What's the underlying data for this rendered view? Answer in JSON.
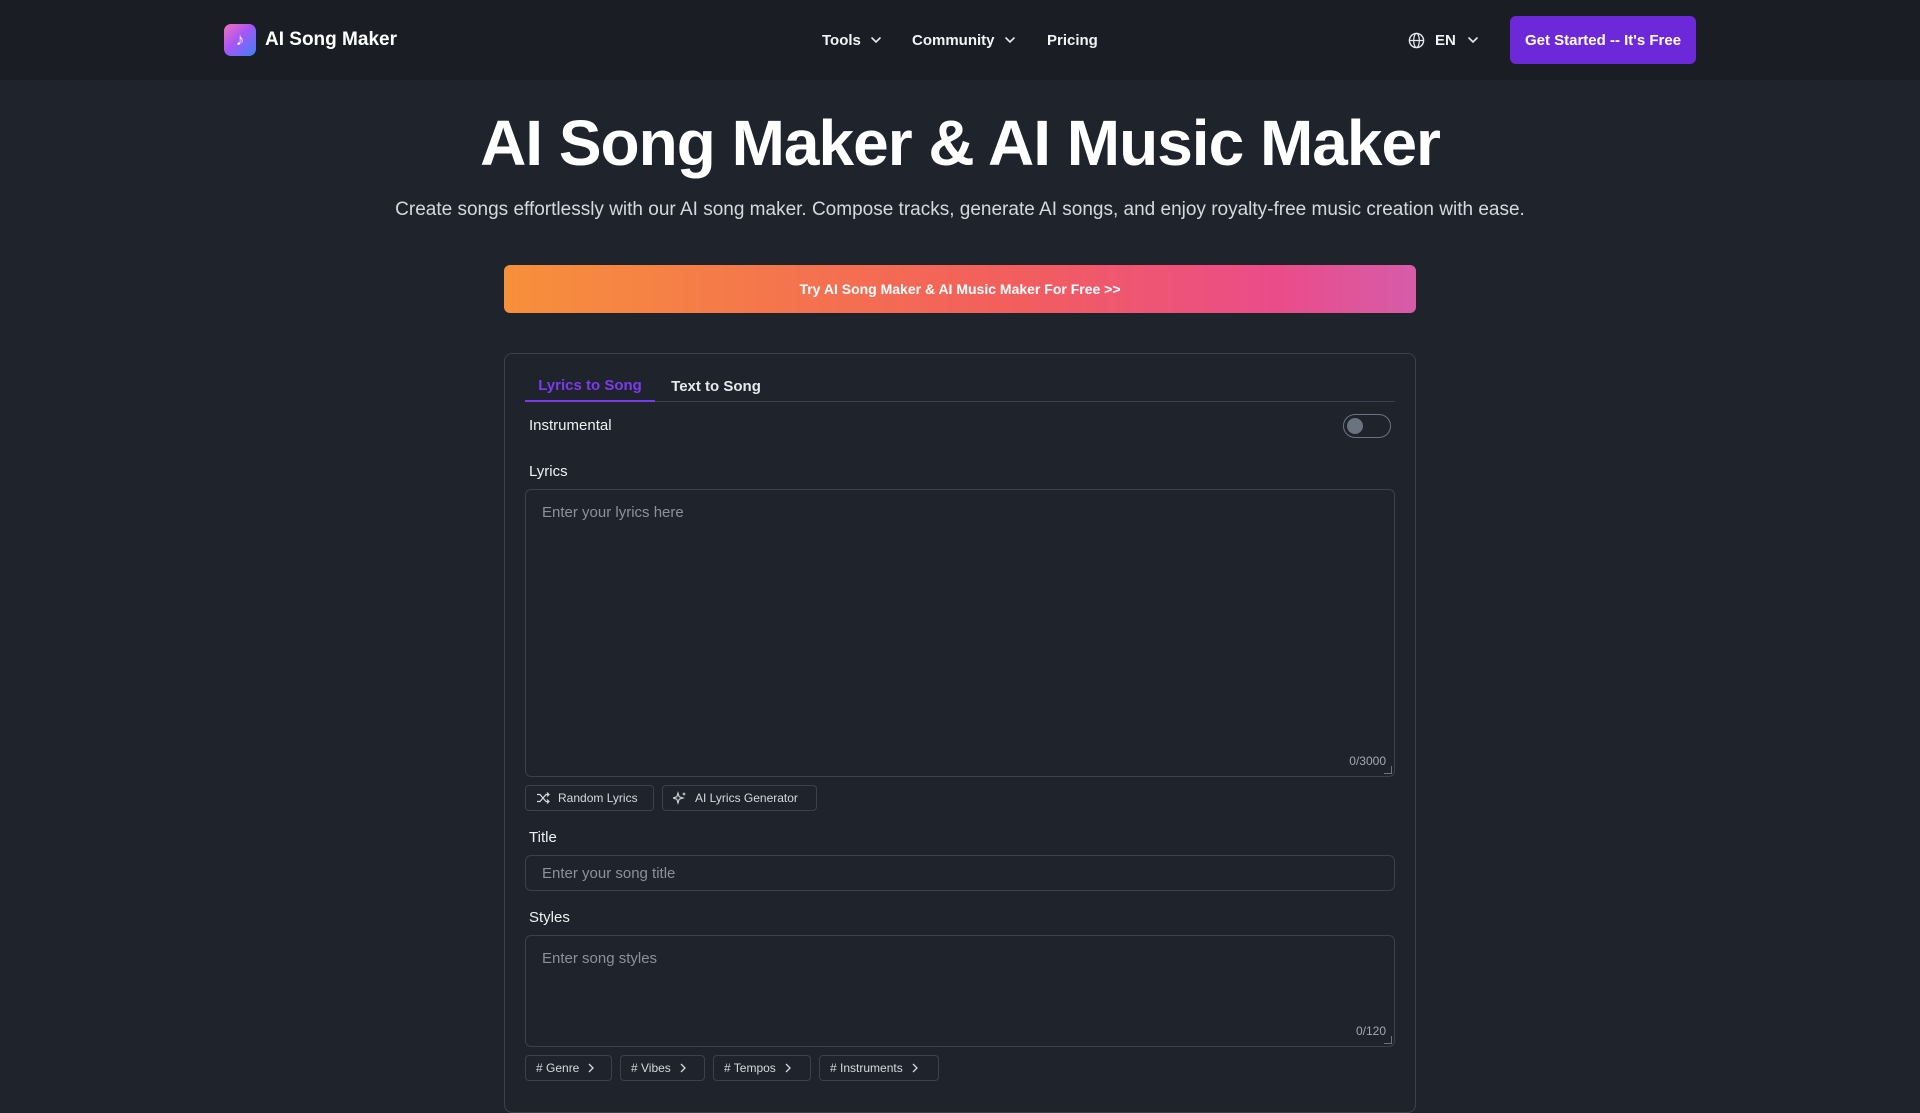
{
  "header": {
    "logo_text": "AI Song Maker",
    "nav": [
      {
        "label": "Tools",
        "has_dropdown": true
      },
      {
        "label": "Community",
        "has_dropdown": true
      },
      {
        "label": "Pricing",
        "has_dropdown": false
      }
    ],
    "language": "EN",
    "cta_label": "Get Started -- It's Free"
  },
  "hero": {
    "title": "AI Song Maker & AI Music Maker",
    "subtitle": "Create songs effortlessly with our AI song maker. Compose tracks, generate AI songs, and enjoy royalty-free music creation with ease.",
    "try_button": "Try AI Song Maker & AI Music Maker For Free >>"
  },
  "form": {
    "tabs": [
      {
        "label": "Lyrics to Song",
        "active": true
      },
      {
        "label": "Text to Song",
        "active": false
      }
    ],
    "instrumental_label": "Instrumental",
    "instrumental_on": false,
    "lyrics_label": "Lyrics",
    "lyrics_placeholder": "Enter your lyrics here",
    "lyrics_counter": "0/3000",
    "random_lyrics": "Random Lyrics",
    "ai_lyrics_generator": "AI Lyrics Generator",
    "title_label": "Title",
    "title_placeholder": "Enter your song title",
    "styles_label": "Styles",
    "styles_placeholder": "Enter song styles",
    "styles_counter": "0/120",
    "style_tags": [
      "# Genre",
      "# Vibes",
      "# Tempos",
      "# Instruments"
    ]
  },
  "colors": {
    "background": "#1f242c",
    "header_bg": "#1a1e24",
    "accent": "#6d28d9",
    "active_tab": "#7c3aed"
  }
}
